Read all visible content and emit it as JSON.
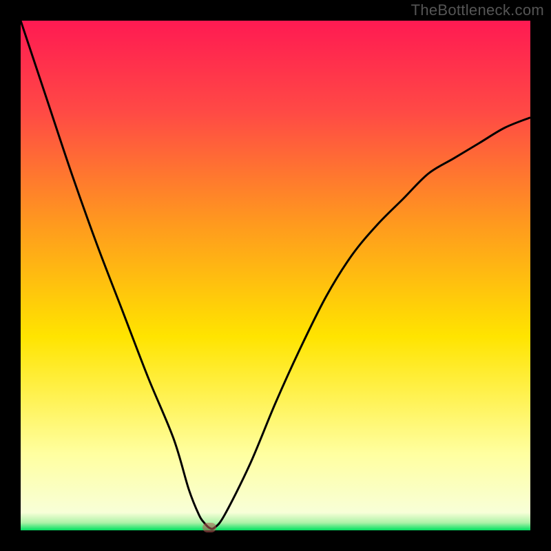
{
  "watermark": "TheBottleneck.com",
  "colors": {
    "top": "#ff1a52",
    "upper": "#ff5a3c",
    "mid": "#ffb300",
    "lower_mid": "#ffe400",
    "pale": "#ffffb0",
    "green": "#00e060",
    "marker": "#be5a55",
    "curve": "#000000",
    "frame": "#000000"
  },
  "chart_data": {
    "type": "line",
    "title": "",
    "xlabel": "",
    "ylabel": "",
    "xlim": [
      0,
      100
    ],
    "ylim": [
      0,
      100
    ],
    "grid": false,
    "legend": false,
    "series": [
      {
        "name": "bottleneck-curve",
        "x": [
          0,
          5,
          10,
          15,
          20,
          25,
          30,
          33,
          35,
          36,
          37,
          38,
          40,
          45,
          50,
          55,
          60,
          65,
          70,
          75,
          80,
          85,
          90,
          95,
          100
        ],
        "y": [
          100,
          85,
          70,
          56,
          43,
          30,
          18,
          8,
          3,
          1.5,
          0.5,
          0.5,
          3,
          13,
          25,
          36,
          46,
          54,
          60,
          65,
          70,
          73,
          76,
          79,
          81
        ]
      }
    ],
    "marker": {
      "x": 37,
      "y": 0.5
    },
    "gradient_stops": [
      {
        "pos": 0.0,
        "color": "#ff1a52"
      },
      {
        "pos": 0.18,
        "color": "#ff4a45"
      },
      {
        "pos": 0.4,
        "color": "#ff9a1e"
      },
      {
        "pos": 0.62,
        "color": "#ffe400"
      },
      {
        "pos": 0.85,
        "color": "#ffffa0"
      },
      {
        "pos": 0.965,
        "color": "#f8ffd8"
      },
      {
        "pos": 0.985,
        "color": "#aef2a8"
      },
      {
        "pos": 1.0,
        "color": "#00e060"
      }
    ]
  }
}
